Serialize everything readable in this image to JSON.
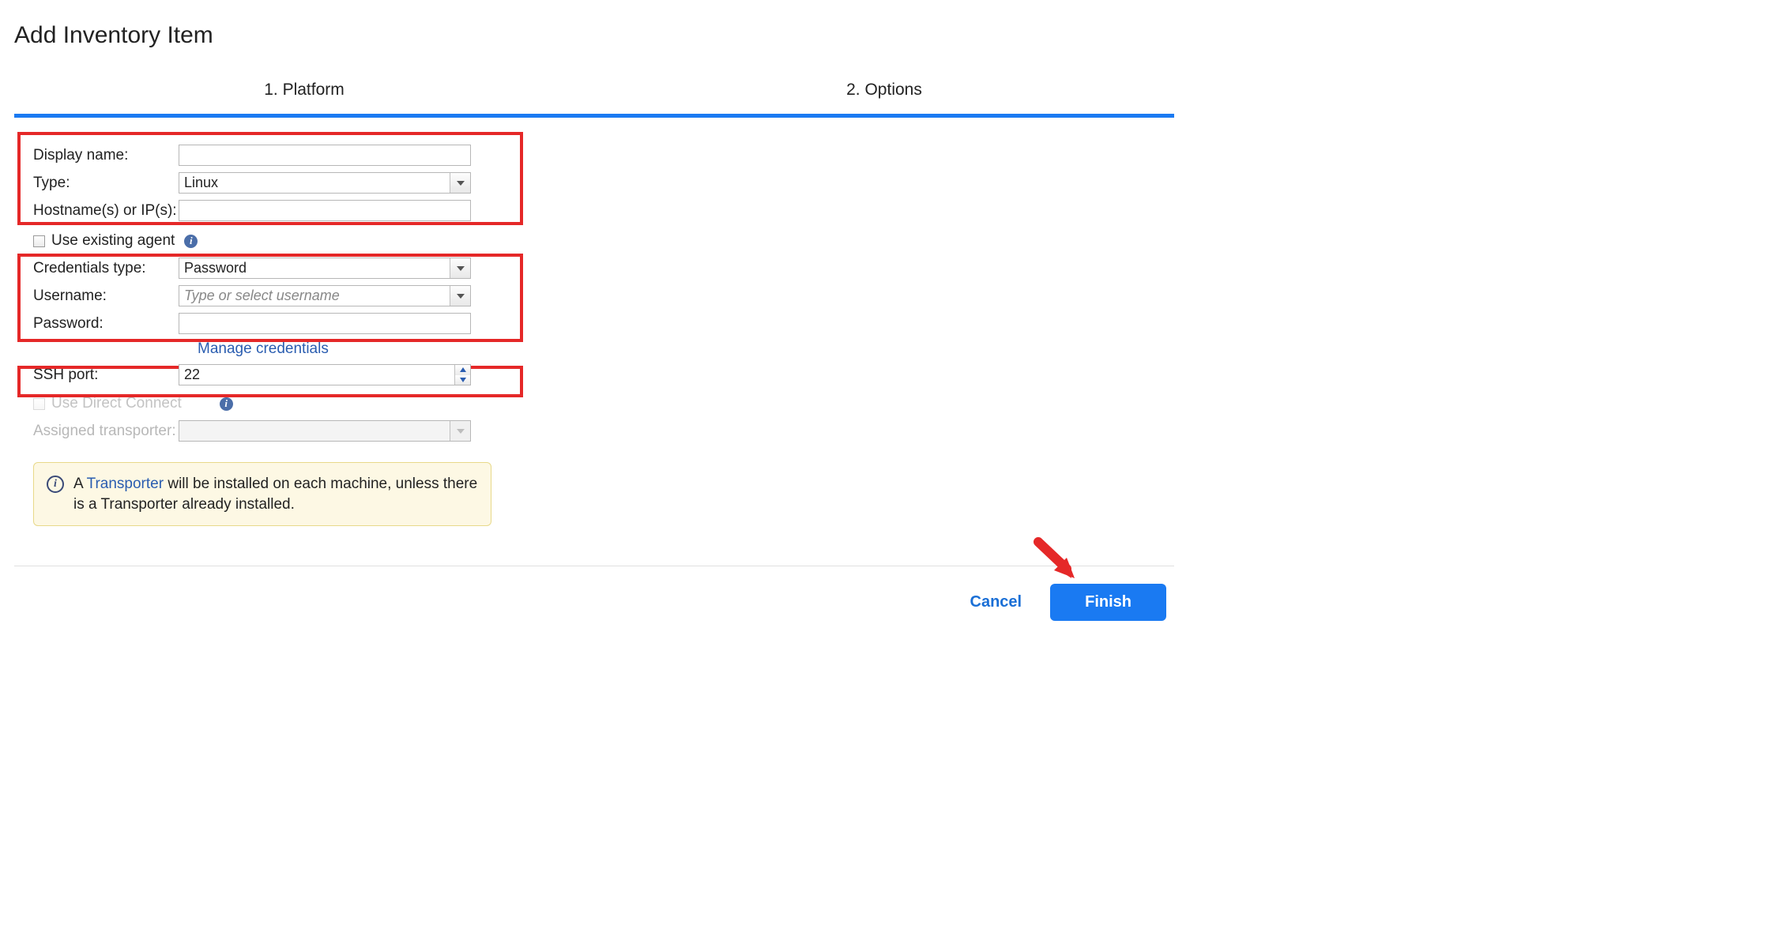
{
  "title": "Add Inventory Item",
  "steps": {
    "s1": "1. Platform",
    "s2": "2. Options"
  },
  "labels": {
    "display_name": "Display name:",
    "type": "Type:",
    "hostnames": "Hostname(s) or IP(s):",
    "use_existing": "Use existing agent",
    "credentials_type": "Credentials type:",
    "username": "Username:",
    "password": "Password:",
    "manage": "Manage credentials",
    "ssh_port": "SSH port:",
    "use_direct_connect": "Use Direct Connect",
    "assigned_transporter": "Assigned transporter:"
  },
  "values": {
    "display_name": "",
    "type": "Linux",
    "hostnames": "",
    "credentials_type": "Password",
    "username": "",
    "username_placeholder": "Type or select username",
    "password": "",
    "ssh_port": "22"
  },
  "notice": {
    "a": "A ",
    "link": "Transporter",
    "rest": " will be installed on each machine, unless there is a Transporter already installed."
  },
  "buttons": {
    "cancel": "Cancel",
    "finish": "Finish"
  }
}
